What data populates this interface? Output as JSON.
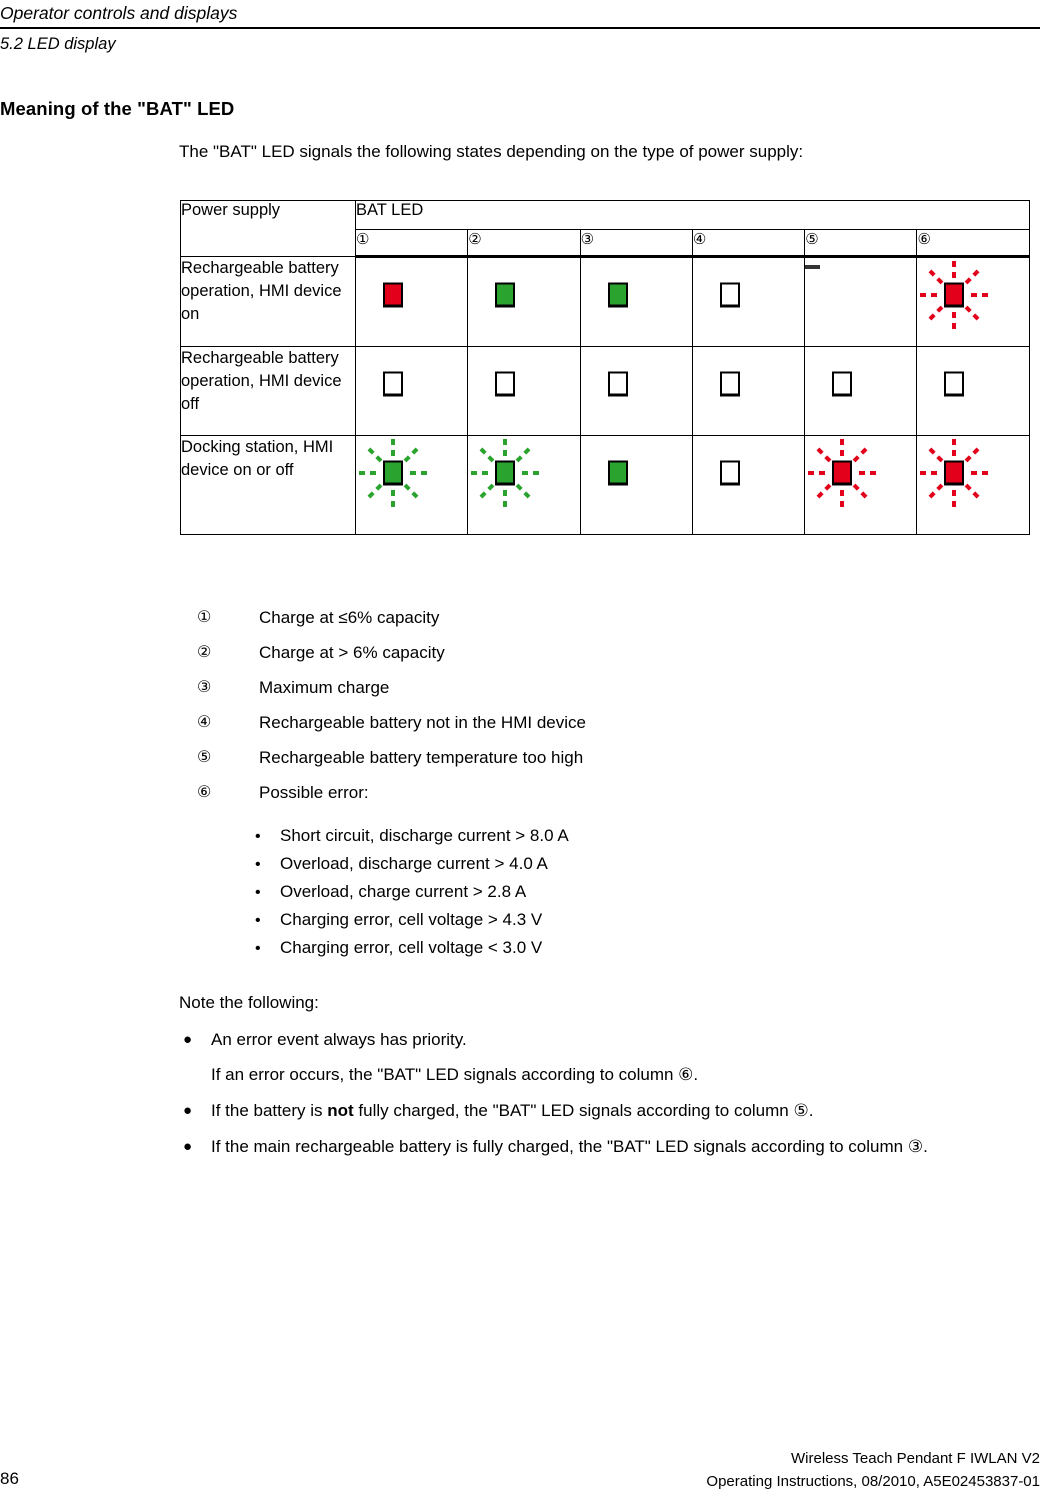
{
  "header": {
    "chapter_title": "Operator controls and displays",
    "section_title": "5.2 LED display"
  },
  "heading": "Meaning of the \"BAT\" LED",
  "intro": "The \"BAT\" LED signals the following states depending on the type of power supply:",
  "table": {
    "col_power_supply": "Power supply",
    "col_group": "BAT LED",
    "column_numbers": [
      "①",
      "②",
      "③",
      "④",
      "⑤",
      "⑥"
    ],
    "rows": [
      {
        "label": "Rechargeable battery operation, HMI device on",
        "states": [
          "red",
          "green",
          "green",
          "off",
          "dash",
          "red-flashing"
        ]
      },
      {
        "label": "Rechargeable battery operation, HMI device off",
        "states": [
          "off",
          "off",
          "off",
          "off",
          "off",
          "off"
        ]
      },
      {
        "label": "Docking station, HMI device on or off",
        "states": [
          "green-flashing",
          "green-flashing",
          "green",
          "off",
          "red-flashing",
          "red-flashing"
        ]
      }
    ]
  },
  "legend": [
    {
      "num": "①",
      "text": "Charge at ≤6% capacity"
    },
    {
      "num": "②",
      "text": "Charge at > 6% capacity"
    },
    {
      "num": "③",
      "text": "Maximum charge"
    },
    {
      "num": "④",
      "text": "Rechargeable battery not in the HMI device"
    },
    {
      "num": "⑤",
      "text": "Rechargeable battery temperature too high"
    },
    {
      "num": "⑥",
      "text": "Possible error:"
    }
  ],
  "error_bullets": [
    "Short circuit, discharge current > 8.0 A",
    "Overload, discharge current > 4.0 A",
    "Overload, charge current > 2.8 A",
    "Charging error, cell voltage > 4.3 V",
    "Charging error, cell voltage < 3.0 V"
  ],
  "note": {
    "intro": "Note the following:",
    "items": [
      {
        "text": "An error event always has priority.",
        "sub": "If an error occurs, the \"BAT\" LED signals according to column ⑥."
      },
      {
        "prefix": "If the battery is ",
        "emphasis": "not",
        "suffix": " fully charged, the \"BAT\" LED signals according to column ⑤."
      },
      {
        "text": "If the main rechargeable battery is fully charged, the \"BAT\" LED signals according to column ③."
      }
    ],
    "bullet_glyph": "●"
  },
  "footer": {
    "page_number": "86",
    "product": "Wireless Teach Pendant F IWLAN V2",
    "doc_info": "Operating Instructions, 08/2010, A5E02453837-01"
  },
  "colors": {
    "led_red": "#E2001A",
    "led_green": "#2AA42E",
    "led_off": "#FFFFFF"
  }
}
